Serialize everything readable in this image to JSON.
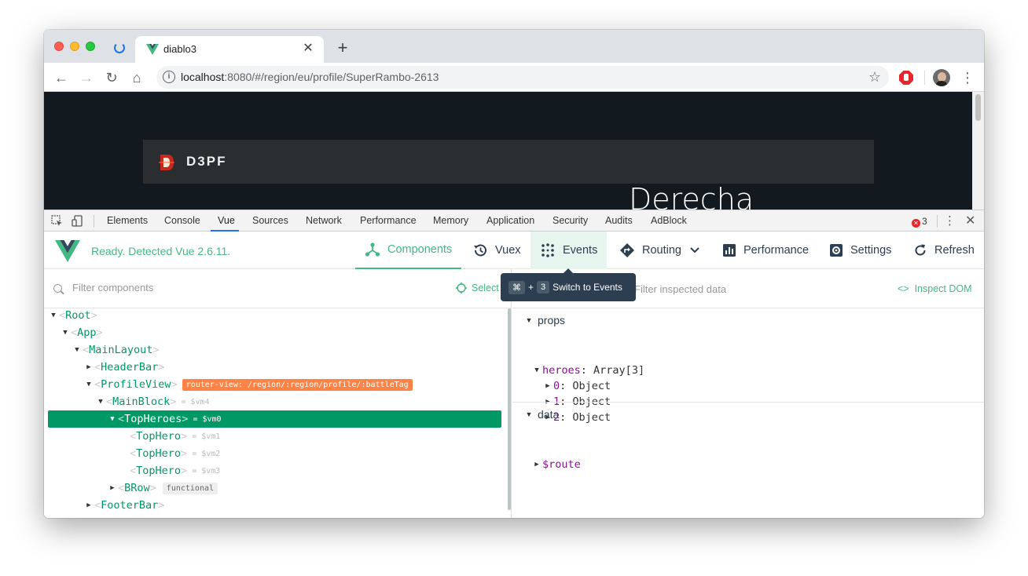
{
  "browser": {
    "tab_title": "diablo3",
    "url_host": "localhost",
    "url_rest": ":8080/#/region/eu/profile/SuperRambo-2613"
  },
  "page": {
    "brand": "D3PF",
    "hero_name": "Derecha"
  },
  "devtools": {
    "tabs": [
      "Elements",
      "Console",
      "Vue",
      "Sources",
      "Network",
      "Performance",
      "Memory",
      "Application",
      "Security",
      "Audits",
      "AdBlock"
    ],
    "active_tab": "Vue",
    "error_count": "3"
  },
  "vue": {
    "status": "Ready. Detected Vue 2.6.11.",
    "nav": {
      "components": "Components",
      "vuex": "Vuex",
      "events": "Events",
      "routing": "Routing",
      "performance": "Performance",
      "settings": "Settings",
      "refresh": "Refresh"
    },
    "tooltip": {
      "key1": "⌘",
      "plus": "+",
      "key2": "3",
      "text": "Switch to Events"
    },
    "filter_components_placeholder": "Filter components",
    "select_label": "Select",
    "filter_inspected_placeholder": "Filter inspected data",
    "inspect_dom_label": "Inspect DOM",
    "tree": [
      {
        "name": "Root",
        "arrow": "▼",
        "indent": 0
      },
      {
        "name": "App",
        "arrow": "▼",
        "indent": 1
      },
      {
        "name": "MainLayout",
        "arrow": "▼",
        "indent": 2
      },
      {
        "name": "HeaderBar",
        "arrow": "▶",
        "indent": 3
      },
      {
        "name": "ProfileView",
        "arrow": "▼",
        "indent": 3,
        "tag": "router-view: /region/:region/profile/:battleTag"
      },
      {
        "name": "MainBlock",
        "arrow": "▼",
        "indent": 4,
        "vm": "= $vm4"
      },
      {
        "name": "TopHeroes",
        "arrow": "▼",
        "indent": 5,
        "vm": "= $vm0",
        "selected": true
      },
      {
        "name": "TopHero",
        "arrow": "",
        "indent": 6,
        "vm": "= $vm1"
      },
      {
        "name": "TopHero",
        "arrow": "",
        "indent": 6,
        "vm": "= $vm2"
      },
      {
        "name": "TopHero",
        "arrow": "",
        "indent": 6,
        "vm": "= $vm3"
      },
      {
        "name": "BRow",
        "arrow": "▶",
        "indent": 5,
        "func": "functional"
      },
      {
        "name": "FooterBar",
        "arrow": "▶",
        "indent": 3
      }
    ],
    "inspector": {
      "props_title": "props",
      "heroes_key": "heroes",
      "heroes_value": "Array[3]",
      "items": [
        {
          "key": "0",
          "value": "Object"
        },
        {
          "key": "1",
          "value": "Object"
        },
        {
          "key": "2",
          "value": "Object"
        }
      ],
      "data_title": "data",
      "route_key": "$route"
    }
  },
  "colors": {
    "vue_green": "#42b983",
    "selected_row": "#009966",
    "router_tag": "#ff8344"
  }
}
